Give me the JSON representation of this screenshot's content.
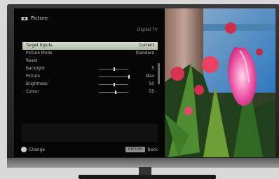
{
  "menu": {
    "title": "Picture",
    "source": "Digital TV",
    "items": [
      {
        "label": "Target Inputs",
        "value": "Current",
        "selected": true
      },
      {
        "label": "Picture Mode",
        "value": "Standard"
      },
      {
        "label": "Reset",
        "value": ""
      },
      {
        "label": "Backlight",
        "value": "5",
        "level": 0.5
      },
      {
        "label": "Picture",
        "value": "Max",
        "level": 1.0
      },
      {
        "label": "Brightness",
        "value": "50",
        "level": 0.5
      },
      {
        "label": "Colour",
        "value": "55",
        "level": 0.55
      }
    ]
  },
  "footer": {
    "left": "Change",
    "button": "RETURN",
    "right": "Back"
  },
  "icons": {
    "picture": "picture-icon",
    "change": "change-icon"
  },
  "colors": {
    "selected_row": "#cdd5c2",
    "menu_bg": "#050505",
    "frame": "#2b2b2b"
  }
}
